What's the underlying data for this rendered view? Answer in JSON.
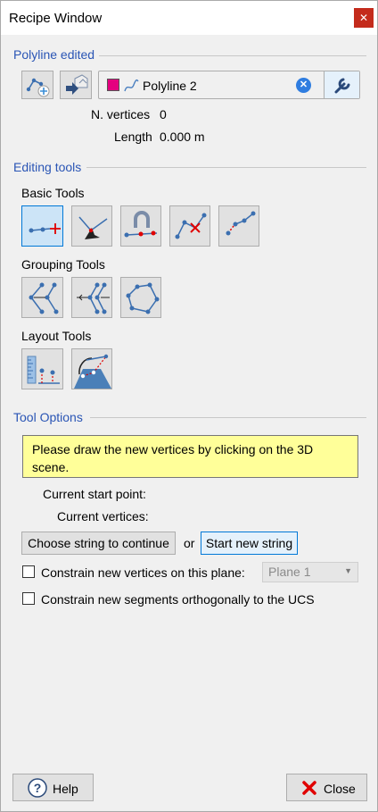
{
  "window": {
    "title": "Recipe Window"
  },
  "polyline": {
    "section_title": "Polyline edited",
    "selected_name": "Polyline 2",
    "swatch_color": "#e4007f",
    "vertices_label": "N. vertices",
    "vertices_value": "0",
    "length_label": "Length",
    "length_value": "0.000 m"
  },
  "editing": {
    "section_title": "Editing tools",
    "basic_title": "Basic Tools",
    "grouping_title": "Grouping Tools",
    "layout_title": "Layout Tools"
  },
  "options": {
    "section_title": "Tool Options",
    "note": "Please draw the new vertices by clicking on the 3D scene.",
    "start_point_label": "Current start point:",
    "vertices_label": "Current vertices:",
    "choose_button": "Choose string to continue",
    "or_text": "or",
    "start_button": "Start new string",
    "constrain_plane_label": "Constrain new vertices on this plane:",
    "plane_value": "Plane 1",
    "constrain_ucs_label": "Constrain new segments orthogonally to the UCS"
  },
  "footer": {
    "help": "Help",
    "close": "Close"
  },
  "colors": {
    "accent": "#2a55b5",
    "swatch": "#e4007f",
    "close_red": "#e00000"
  }
}
